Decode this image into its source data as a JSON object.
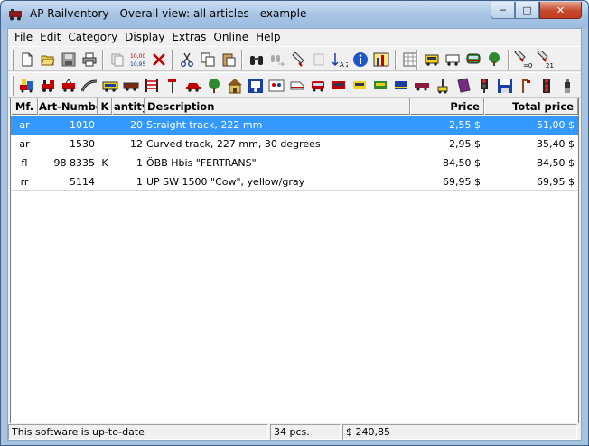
{
  "window": {
    "title": "AP Railventory - Overall view: all articles - example",
    "min_glyph": "─",
    "max_glyph": "□",
    "close_glyph": "✕"
  },
  "menu": [
    {
      "first": "F",
      "rest": "ile"
    },
    {
      "first": "E",
      "rest": "dit"
    },
    {
      "first": "C",
      "rest": "ategory"
    },
    {
      "first": "D",
      "rest": "isplay"
    },
    {
      "first": "E",
      "rest": "xtras"
    },
    {
      "first": "O",
      "rest": "nline"
    },
    {
      "first": "H",
      "rest": "elp"
    }
  ],
  "toolbar1": {
    "labels": {
      "sort": "A Z",
      "count_top": "10,00",
      "count_bottom": "10,95",
      "sub0": "=0",
      "sub21": "21"
    }
  },
  "table": {
    "headers": [
      "Mf.",
      "Art-Number",
      "K",
      "antity",
      "Description",
      "Price",
      "Total price"
    ],
    "rows": [
      {
        "mf": "ar",
        "art": "1010",
        "k": "",
        "qty": "20",
        "desc": "Straight track, 222 mm",
        "price": "2,55 $",
        "total": "51,00 $",
        "selected": true
      },
      {
        "mf": "ar",
        "art": "1530",
        "k": "",
        "qty": "12",
        "desc": "Curved track, 227 mm, 30 degrees",
        "price": "2,95 $",
        "total": "35,40 $",
        "selected": false
      },
      {
        "mf": "fl",
        "art": "98 8335",
        "k": "K",
        "qty": "1",
        "desc": "ÖBB Hbis \"FERTRANS\"",
        "price": "84,50 $",
        "total": "84,50 $",
        "selected": false
      },
      {
        "mf": "rr",
        "art": "5114",
        "k": "",
        "qty": "1",
        "desc": "UP SW 1500 \"Cow\", yellow/gray",
        "price": "69,95 $",
        "total": "69,95 $",
        "selected": false
      }
    ]
  },
  "status": {
    "message": "This software is up-to-date",
    "pieces": "34 pcs.",
    "total": "$ 240,85"
  },
  "colors": {
    "selection": "#3399ff",
    "close": "#c23c1d",
    "titlebar": "#a6c3e3"
  }
}
